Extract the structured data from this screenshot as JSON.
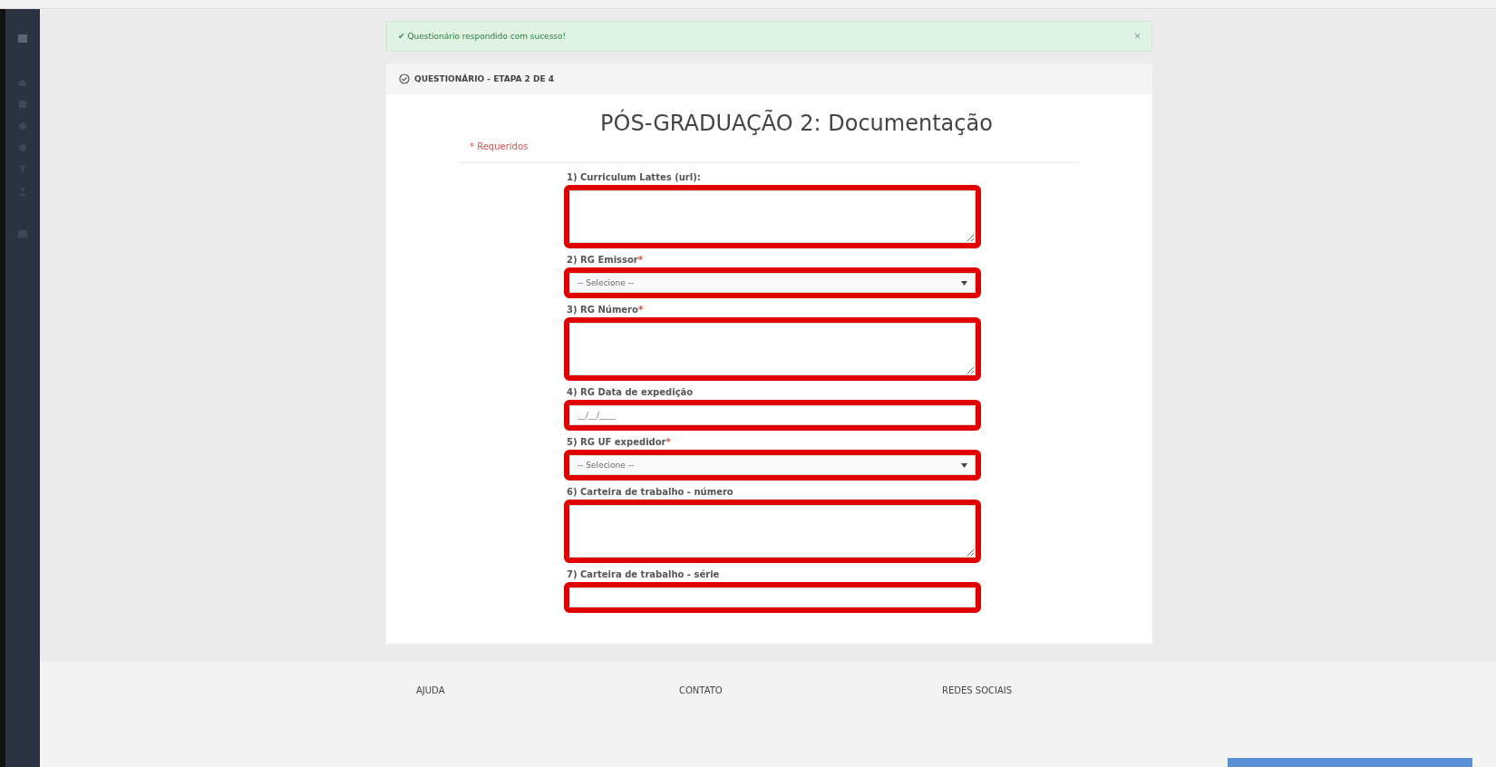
{
  "alert": {
    "icon": "✔",
    "message": "Questionário respondido com sucesso!",
    "close": "×"
  },
  "card": {
    "header": "QUESTIONÁRIO - ETAPA 2 DE 4",
    "title": "PÓS-GRADUAÇÃO 2: Documentação",
    "required_note": "* Requeridos"
  },
  "fields": [
    {
      "kind": "textarea",
      "label": "1) Curriculum Lattes (url):",
      "highlighted": true
    },
    {
      "kind": "select",
      "label": "2) RG Emissor",
      "required_mark": "*",
      "value": "-- Selecione --",
      "highlighted": true
    },
    {
      "kind": "textarea",
      "label": "3) RG Número",
      "required_mark": "*",
      "highlighted": true
    },
    {
      "kind": "input",
      "label": "4) RG Data de expedição",
      "placeholder": "__/__/____",
      "highlighted": true
    },
    {
      "kind": "select",
      "label": "5) RG UF expedidor",
      "required_mark": "*",
      "value": "-- Selecione --",
      "highlighted": true
    },
    {
      "kind": "textarea",
      "label": "6) Carteira de trabalho - número",
      "highlighted": true
    },
    {
      "kind": "input",
      "label": "7) Carteira de trabalho - série",
      "highlighted": true
    }
  ],
  "footer": {
    "headings": [
      "AJUDA",
      "CONTATO",
      "REDES SOCIAIS"
    ]
  }
}
